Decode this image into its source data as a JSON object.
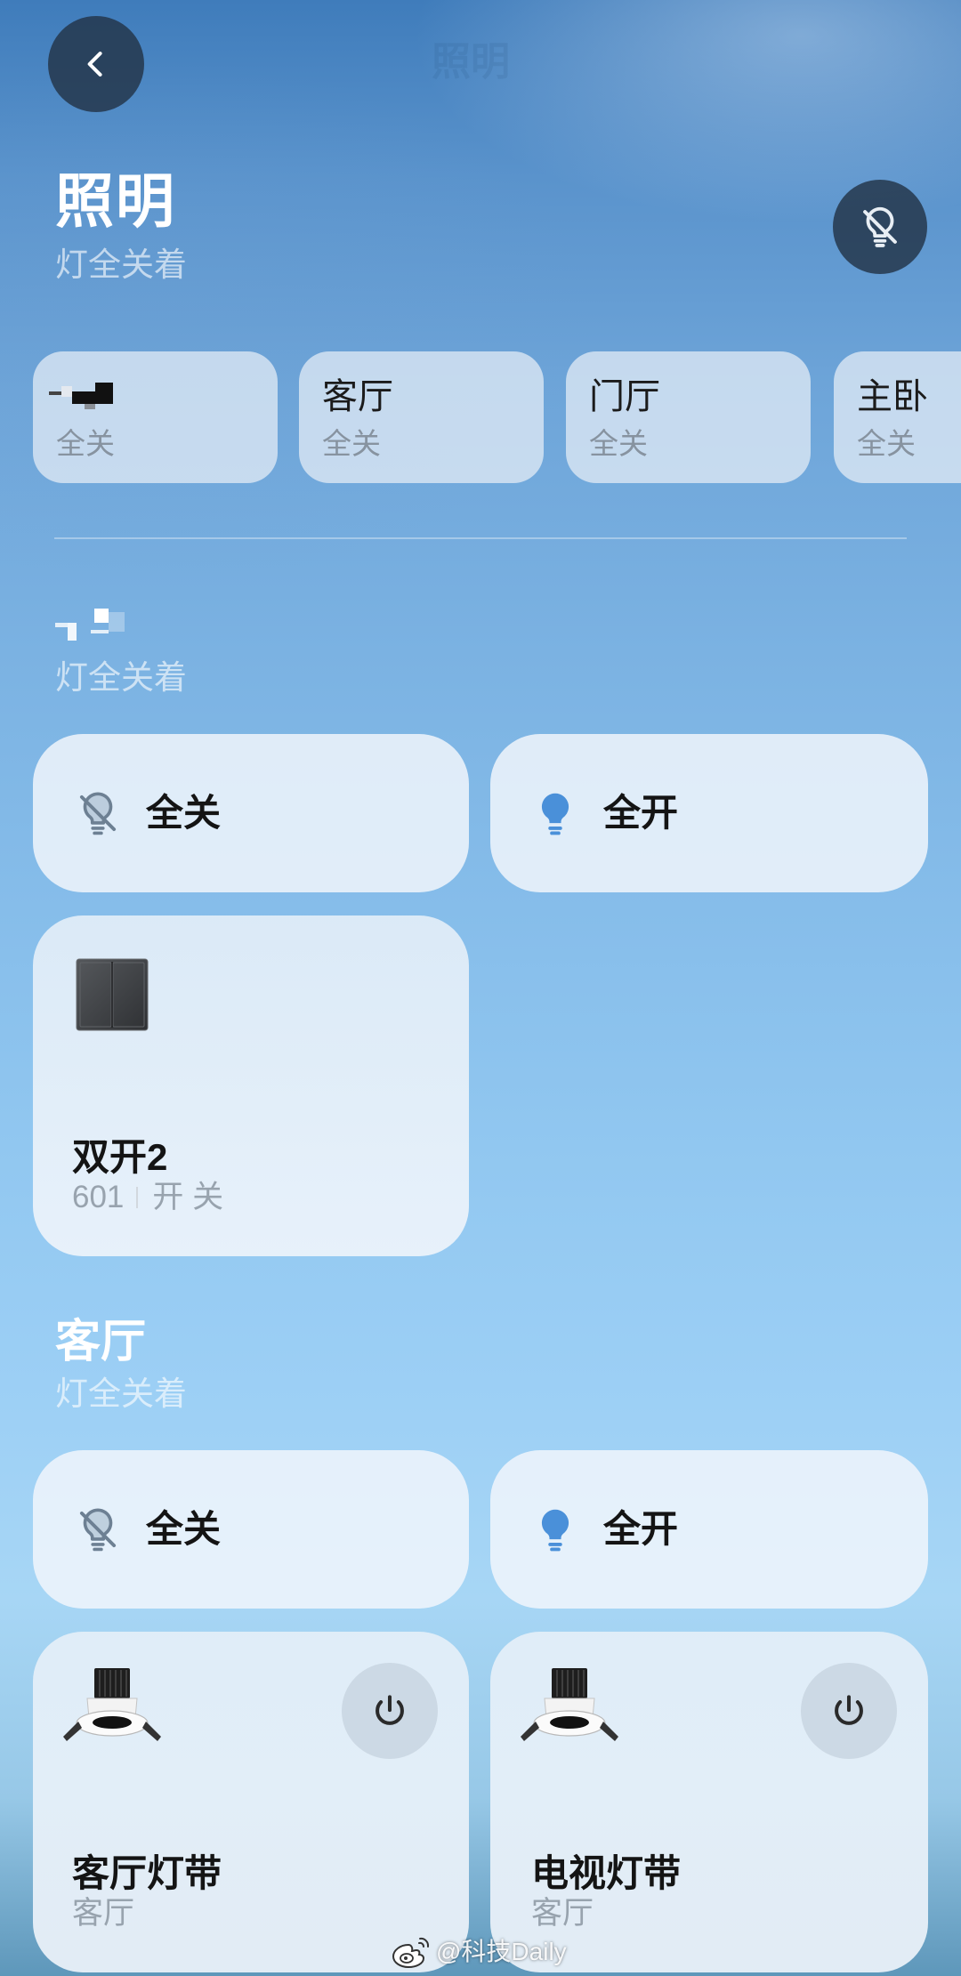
{
  "header": {
    "collapsed_title": "照明",
    "back_icon": "chevron-left-icon",
    "title": "照明",
    "subtitle": "灯全关着",
    "all_off_icon": "lightbulb-off-icon"
  },
  "rooms": [
    {
      "status": "全关"
    },
    {
      "name": "客厅",
      "status": "全关"
    },
    {
      "name": "门厅",
      "status": "全关"
    },
    {
      "name": "主卧",
      "status": "全关"
    }
  ],
  "sections": [
    {
      "subtitle": "灯全关着",
      "actions": {
        "all_off": {
          "label": "全关",
          "icon": "lightbulb-off-icon"
        },
        "all_on": {
          "label": "全开",
          "icon": "lightbulb-icon"
        }
      },
      "devices": [
        {
          "name": "双开2",
          "room": "601",
          "state": "开 关",
          "icon": "double-switch-icon"
        }
      ]
    },
    {
      "title": "客厅",
      "subtitle": "灯全关着",
      "actions": {
        "all_off": {
          "label": "全关",
          "icon": "lightbulb-off-icon"
        },
        "all_on": {
          "label": "全开",
          "icon": "lightbulb-icon"
        }
      },
      "devices": [
        {
          "name": "客厅灯带",
          "room": "客厅",
          "icon": "downlight-icon",
          "control_icon": "power-icon"
        },
        {
          "name": "电视灯带",
          "room": "客厅",
          "icon": "downlight-icon",
          "control_icon": "power-icon"
        }
      ]
    }
  ],
  "watermark": {
    "text": "@科技Daily",
    "icon": "weibo-logo-icon"
  },
  "colors": {
    "accent_blue": "#4a90d9",
    "header_button_bg": "#24364a",
    "text_primary": "#141414",
    "text_secondary": "#8793a0",
    "bulb_off_grey": "#6d8093"
  }
}
